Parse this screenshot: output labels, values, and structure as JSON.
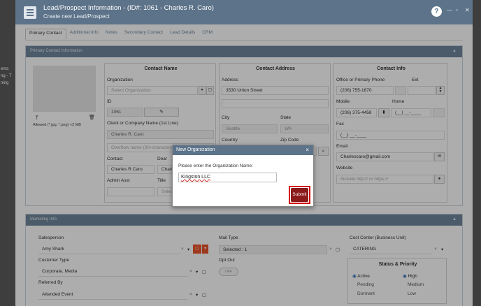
{
  "bg": {
    "fragments": [
      "ents",
      "ng - T",
      "ning"
    ]
  },
  "title": {
    "main": "Lead/Prospect Information - (ID#: 1061 - Charles R. Caro)",
    "sub": "Create new Lead/Prospect",
    "help": "?",
    "minimize": "—",
    "restore": "▫",
    "close": "✕"
  },
  "tabs": [
    "Primary Contact",
    "Additional Info",
    "Notes",
    "Secondary Contact",
    "Lead Details",
    "CRM"
  ],
  "primary_panel": {
    "title": "Primary Contact Information",
    "upload_hint": "Allowed (*.jpg, *.png) <2 MB",
    "contact_name": {
      "header": "Contact Name",
      "org_label": "Organization",
      "org_placeholder": "Select Organization",
      "id_label": "ID",
      "id_value": "1061",
      "name_label": "Client or Company Name (1st Line)",
      "name_value": "Charles R. Caro",
      "overflow_placeholder": "Overflow name (30+characters re",
      "contact_label": "Contact",
      "dear_label": "Dear",
      "contact_value": "Charles R Caro",
      "dear_value": "Charle",
      "admin_label": "Admin Asst",
      "title_label": "Title",
      "title_value": "Selec"
    },
    "contact_address": {
      "header": "Contact Address",
      "address_label": "Address",
      "address_value": "3530 Union Street",
      "city_label": "City",
      "state_label": "State",
      "city_value": "Seattle",
      "state_value": "WA",
      "country_label": "Country",
      "zip_label": "Zip Code"
    },
    "contact_info": {
      "header": "Contact Info",
      "office_label": "Office or Primary Phone",
      "ext_label": "Ext",
      "office_value": "(206) 755-1670",
      "mobile_label": "Mobile",
      "home_label": "Home",
      "mobile_value": "(206) 375-4458",
      "home_value": "(__) __-____",
      "fax_label": "Fax",
      "fax_value": "(__) __-____",
      "email_label": "Email",
      "email_value": "Charlescaro@gmail.com",
      "website_label": "Website",
      "website_placeholder": "Include http:// or https://"
    }
  },
  "marketing_panel": {
    "title": "Marketing Info",
    "salesperson_label": "Salesperson",
    "salesperson_value": "Amy Shark",
    "mail_type_label": "Mail Type",
    "mail_type_value": "Selected : 1",
    "cost_center_label": "Cost Center (Business Unit)",
    "cost_center_value": "CATERING",
    "customer_type_label": "Customer Type",
    "customer_type_value": "Corporate, Media",
    "opt_out_label": "Opt Out",
    "opt_out_value": "OFF",
    "referred_label": "Referred By",
    "referred_value": "Attended Event",
    "status_header": "Status & Priority",
    "status": [
      "Active",
      "Pending",
      "Dormant"
    ],
    "priority": [
      "High",
      "Medium",
      "Low"
    ]
  },
  "dialog": {
    "title": "New Organization",
    "close": "×",
    "prompt": "Please enter the Organization Name:",
    "input_value": "Kingston LLC",
    "submit_label": "Submit"
  },
  "colors": {
    "titlebar": "#5c7389",
    "submit": "#8b1a1a",
    "highlight": "#d40000",
    "orange": "#e8542a"
  }
}
